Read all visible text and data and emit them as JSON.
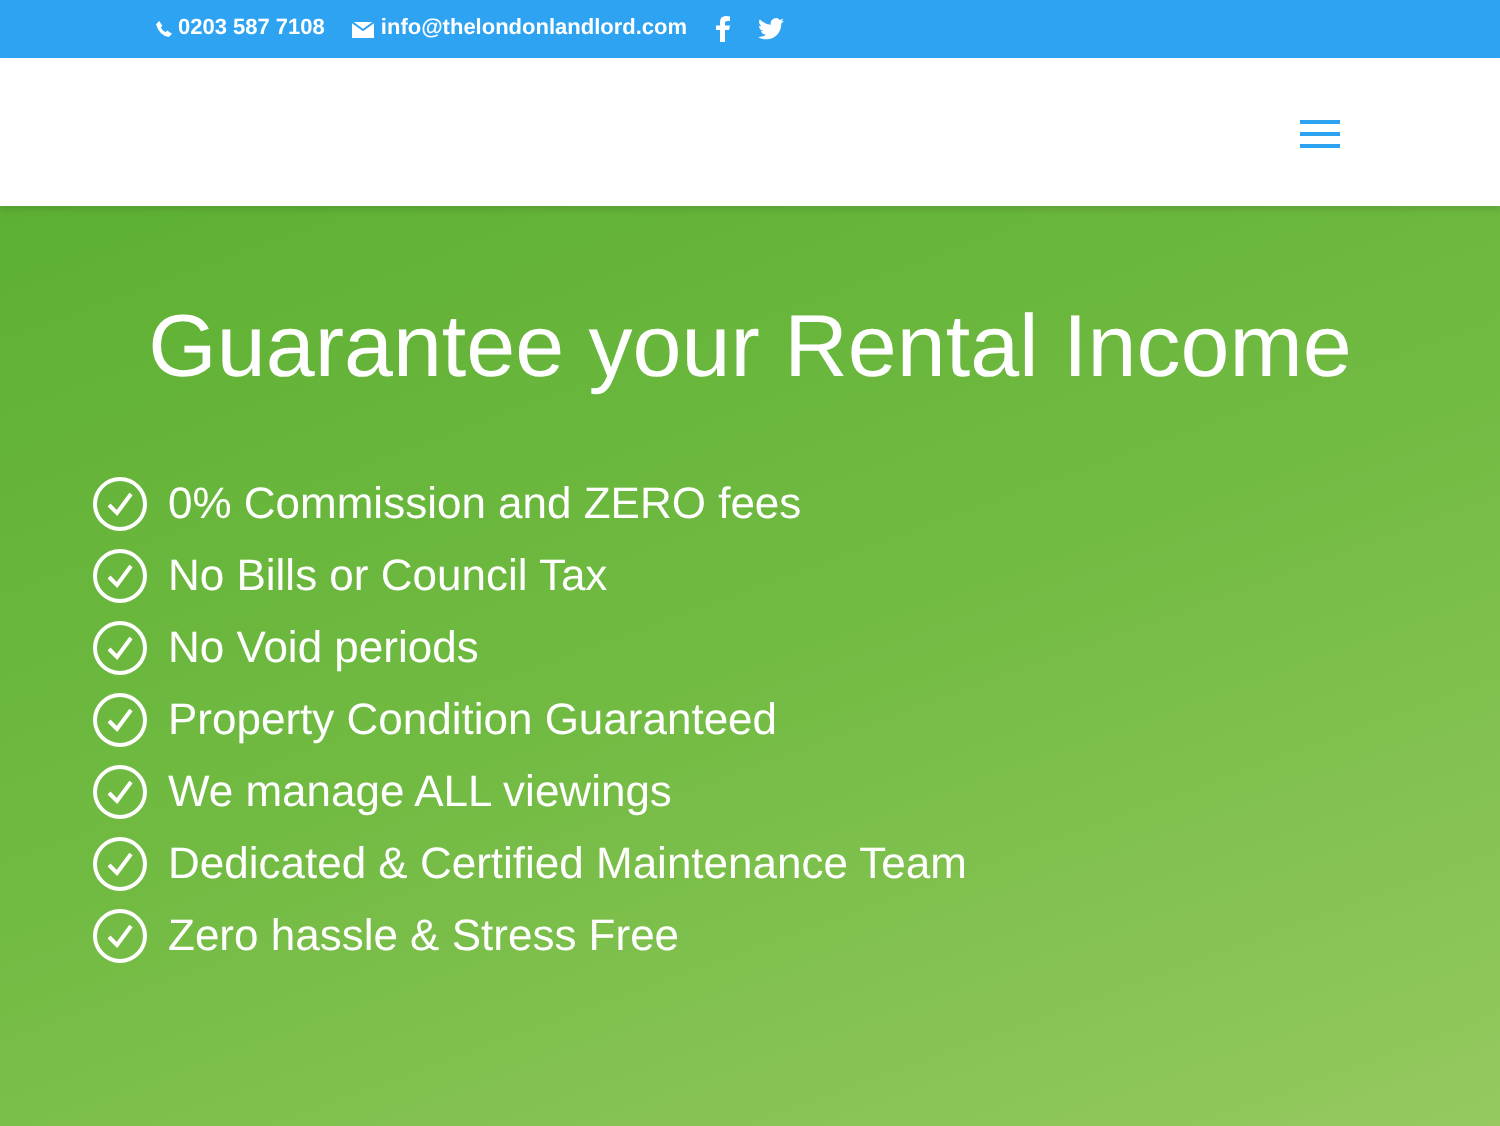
{
  "top_bar": {
    "phone": "0203 587 7108",
    "email": "info@thelondonlandlord.com"
  },
  "hero": {
    "title": "Guarantee your Rental Income",
    "features": [
      "0% Commission and ZERO fees",
      "No Bills or Council Tax",
      "No Void periods",
      "Property Condition Guaranteed",
      "We manage ALL viewings",
      "Dedicated & Certified Maintenance Team",
      "Zero hassle & Stress Free"
    ]
  }
}
